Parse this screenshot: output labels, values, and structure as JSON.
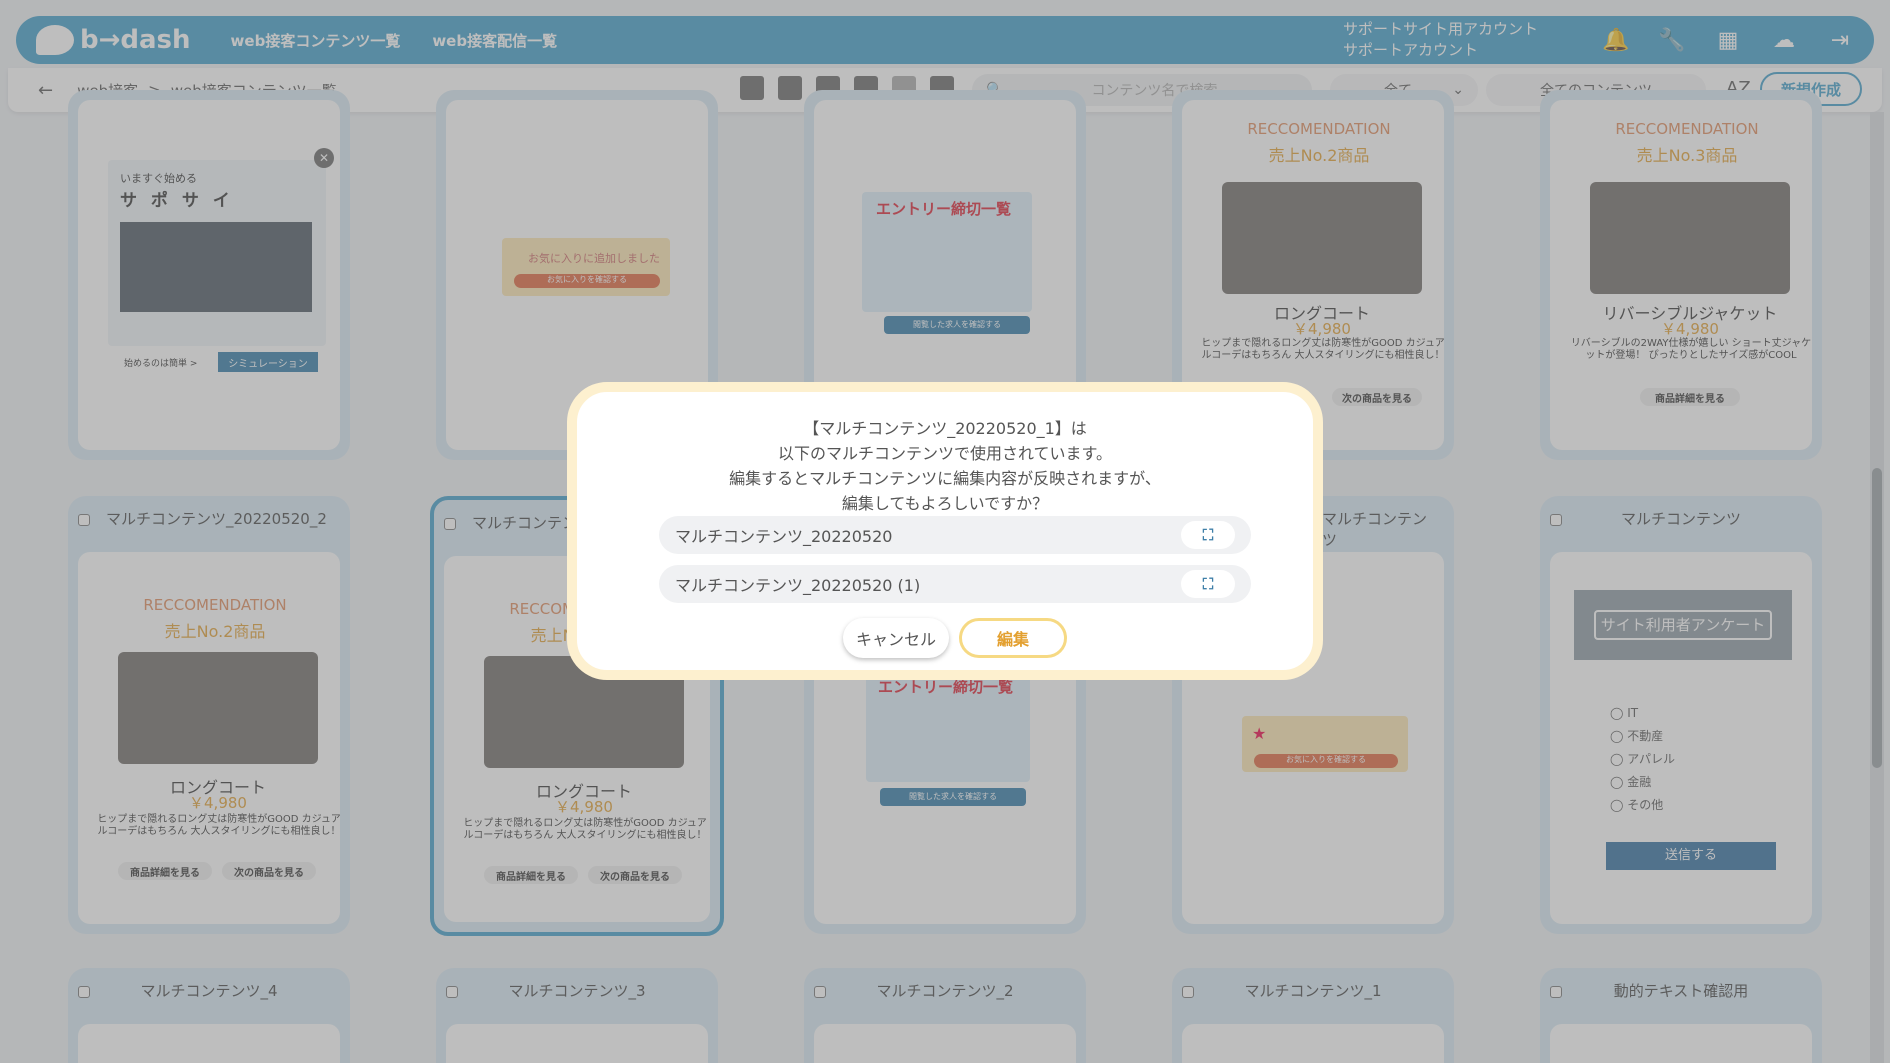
{
  "app": {
    "logo": "b→dash"
  },
  "header": {
    "nav": [
      "web接客コンテンツ一覧",
      "web接客配信一覧"
    ],
    "account_line1": "サポートサイト用アカウント",
    "account_line2": "サポートアカウント"
  },
  "subbar": {
    "breadcrumb": [
      "web接客",
      "web接客コンテンツ一覧"
    ],
    "search_placeholder": "コンテンツ名で検索",
    "filter1": "全て",
    "filter2": "全てのコンテンツ",
    "sort_label": "AZ",
    "new_button": "新規作成"
  },
  "cards": [
    {
      "title": ""
    },
    {
      "title": ""
    },
    {
      "title": ""
    },
    {
      "title": ""
    },
    {
      "title": ""
    },
    {
      "title": "マルチコンテンツ_20220520_2"
    },
    {
      "title": "マルチコンテンツ_20220520_1"
    },
    {
      "title": ""
    },
    {
      "title": "マルチコンテンツ"
    },
    {
      "title": "マルチコンテンツ"
    },
    {
      "title": "マルチコンテンツ_4"
    },
    {
      "title": "マルチコンテンツ_3"
    },
    {
      "title": "マルチコンテンツ_2"
    },
    {
      "title": "マルチコンテンツ_1"
    },
    {
      "title": "動的テキスト確認用"
    }
  ],
  "preview": {
    "reco_label": "RECCOMENDATION",
    "rank2": "売上No.2商品",
    "rank3": "売上No.3商品",
    "long_coat": "ロングコート",
    "long_price": "￥4,980",
    "jacket": "リバーシブルジャケット",
    "jacket_price": "￥4,980",
    "desc_coat": "ヒップまで隠れるロング丈は防寒性がGOOD カジュアルコーデはもちろん 大人スタイリングにも相性良し！",
    "desc_jacket": "リバーシブルの2WAY仕様が嬉しい ショート丈ジャケットが登場！ ぴったりとしたサイズ感がCOOL",
    "btn_detail": "商品詳細を見る",
    "btn_next": "次の商品を見る",
    "fav_text": "お気に入りに追加しました",
    "fav_btn": "お気に入りを確認する",
    "entry_title": "エントリー締切一覧",
    "entry_btn": "閲覧した求人を確認する",
    "survey_title": "サイト利用者アンケート",
    "survey_send": "送信する",
    "start_text": "いますぐ始める",
    "sapo": "サ ポ サ イ",
    "sim_btn": "シミュレーション",
    "easy": "始めるのは簡単 >"
  },
  "modal": {
    "line1": "【マルチコンテンツ_20220520_1】は",
    "line2": "以下のマルチコンテンツで使用されています。",
    "line3": "編集するとマルチコンテンツに編集内容が反映されますが、",
    "line4": "編集してもよろしいですか？",
    "items": [
      "マルチコンテンツ_20220520",
      "マルチコンテンツ_20220520 (1)"
    ],
    "expand_icon": "⛶",
    "cancel": "キャンセル",
    "edit": "編集"
  }
}
